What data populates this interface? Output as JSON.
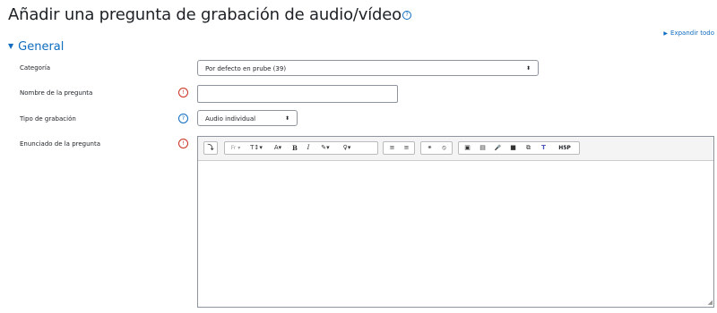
{
  "page": {
    "title": "Añadir una pregunta de grabación de audio/vídeo",
    "help_glyph": "?"
  },
  "expand_all": "Expandir todo",
  "section": {
    "label": "General"
  },
  "form": {
    "category": {
      "label": "Categoría",
      "value": "Por defecto en prube (39)"
    },
    "question_name": {
      "label": "Nombre de la pregunta",
      "value": ""
    },
    "recording_type": {
      "label": "Tipo de grabación",
      "value": "Audio individual"
    },
    "question_text": {
      "label": "Enunciado de la pregunta"
    }
  },
  "toolbar": {
    "toggle": "⤵",
    "paragraph": "Fr",
    "text_size": "T↕",
    "font_color": "A",
    "bold": "B",
    "italic": "I",
    "brush": "✎",
    "bulb": "♀",
    "ul": "≡",
    "ol": "≡",
    "link": "⚭",
    "unlink": "⦸",
    "image": "▣",
    "media": "▤",
    "mic": "🎤",
    "video": "■",
    "copy": "⧉",
    "teams": "T",
    "h5p": "H5P"
  },
  "icons": {
    "required": "!",
    "help": "?"
  },
  "colors": {
    "accent": "#0f6cbf",
    "required": "#ca3120"
  }
}
